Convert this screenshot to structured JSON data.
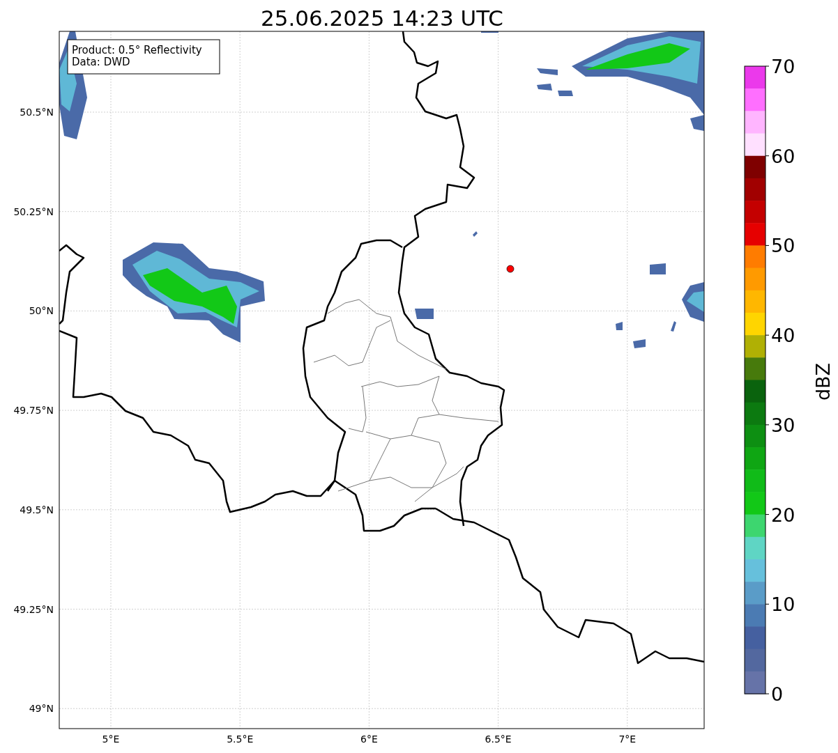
{
  "title": "25.06.2025 14:23 UTC",
  "map": {
    "info_box": [
      "Product: 0.5° Reflectivity",
      "Data: DWD"
    ],
    "yticks": [
      "50.5°N",
      "50.25°N",
      "50°N",
      "49.75°N",
      "49.5°N",
      "49.25°N",
      "49°N"
    ],
    "xticks": [
      "5°E",
      "5.5°E",
      "6°E",
      "6.5°E",
      "7°E"
    ],
    "marker": {
      "color": "#ff0000"
    }
  },
  "colorbar": {
    "label": "dBZ",
    "ticks": [
      "70",
      "60",
      "50",
      "40",
      "30",
      "20",
      "10",
      "0"
    ],
    "bands": [
      {
        "color": "#eb39eb"
      },
      {
        "color": "#ff6fff"
      },
      {
        "color": "#ffb5ff"
      },
      {
        "color": "#ffe0ff"
      },
      {
        "color": "#7f0000"
      },
      {
        "color": "#a10000"
      },
      {
        "color": "#c40000"
      },
      {
        "color": "#e60000"
      },
      {
        "color": "#ff7c00"
      },
      {
        "color": "#ff9a00"
      },
      {
        "color": "#ffb700"
      },
      {
        "color": "#ffd500"
      },
      {
        "color": "#b0b004"
      },
      {
        "color": "#477a0c"
      },
      {
        "color": "#0a630d"
      },
      {
        "color": "#0c7a10"
      },
      {
        "color": "#0d8f12"
      },
      {
        "color": "#0fa613"
      },
      {
        "color": "#10bb18"
      },
      {
        "color": "#12c817"
      },
      {
        "color": "#3dd66f"
      },
      {
        "color": "#5fd5c4"
      },
      {
        "color": "#66c0dc"
      },
      {
        "color": "#5a9cc8"
      },
      {
        "color": "#4b7bb3"
      },
      {
        "color": "#4560a0"
      },
      {
        "color": "#53689f"
      },
      {
        "color": "#6673a8"
      }
    ]
  }
}
